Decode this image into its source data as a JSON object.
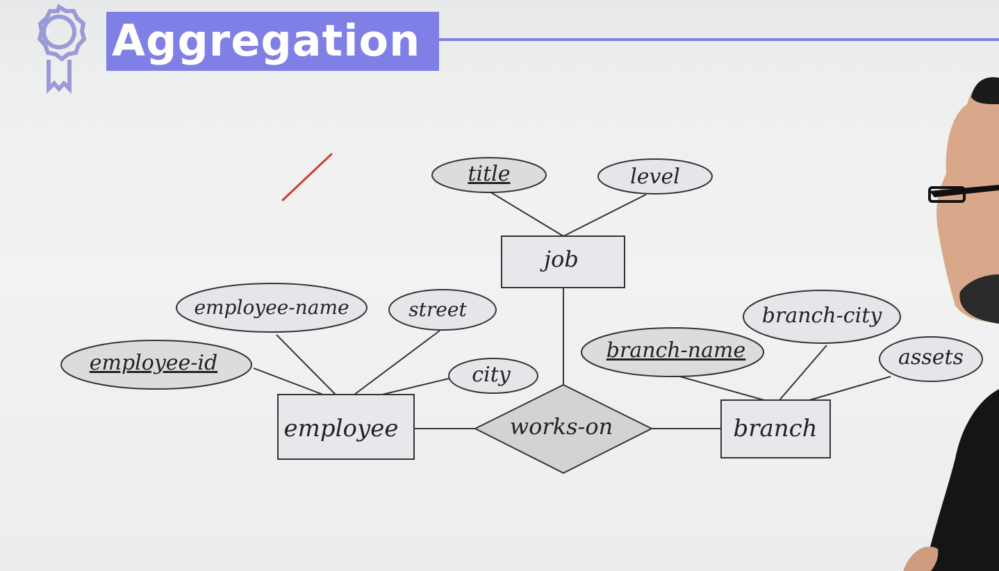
{
  "slide": {
    "title": "Aggregation"
  },
  "diagram": {
    "entities": {
      "job": "job",
      "employee": "employee",
      "branch": "branch"
    },
    "relationship": "works-on",
    "attributes": {
      "title": "title",
      "level": "level",
      "employee_name": "employee-name",
      "street": "street",
      "employee_id": "employee-id",
      "city": "city",
      "branch_name": "branch-name",
      "branch_city": "branch-city",
      "assets": "assets"
    },
    "primary_keys": [
      "title",
      "employee-id",
      "branch-name"
    ]
  },
  "colors": {
    "accent": "#7f7fe6",
    "shape_fill": "#e8e8ec",
    "key_fill": "#dcdcde",
    "relationship_fill": "#d3d3d6",
    "annotation_stroke": "#d23a3a"
  }
}
